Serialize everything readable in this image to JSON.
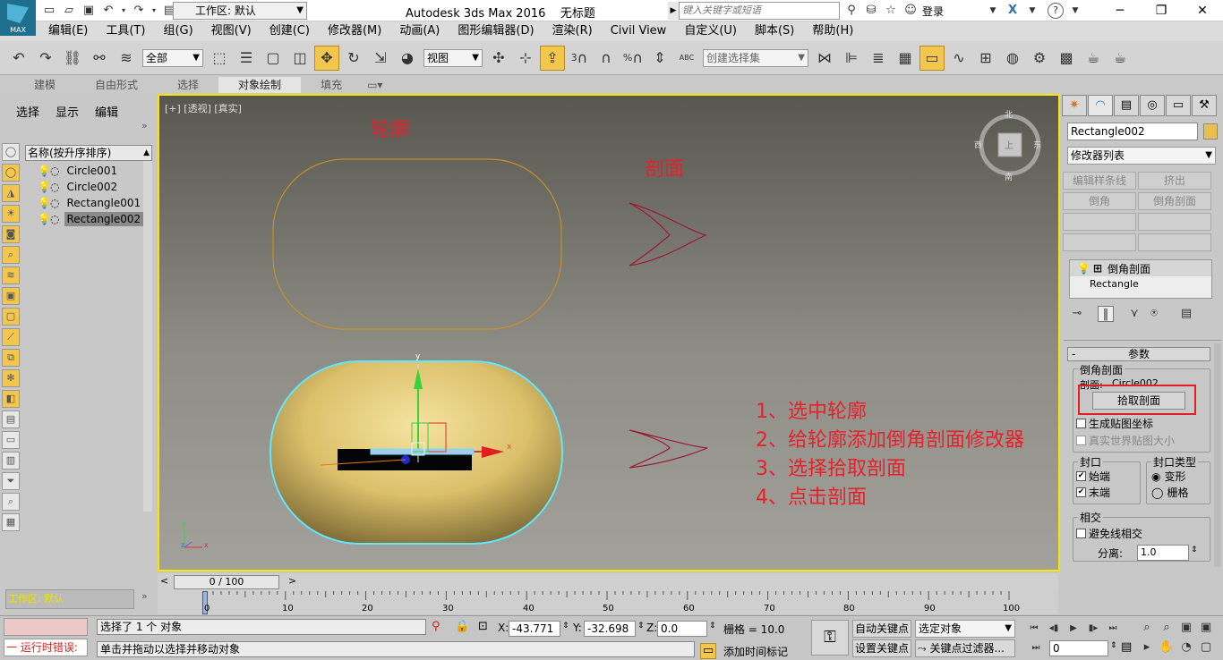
{
  "app": {
    "logo_text": "MAX",
    "title": "Autodesk 3ds Max 2016",
    "document": "无标题",
    "workspace": "工作区: 默认",
    "search_placeholder": "键入关键字或短语",
    "login": "登录",
    "window_min": "─",
    "window_restore": "❐",
    "window_close": "✕"
  },
  "menu": [
    "编辑(E)",
    "工具(T)",
    "组(G)",
    "视图(V)",
    "创建(C)",
    "修改器(M)",
    "动画(A)",
    "图形编辑器(D)",
    "渲染(R)",
    "Civil View",
    "自定义(U)",
    "脚本(S)",
    "帮助(H)"
  ],
  "toolbar": {
    "filter": "全部",
    "refcoord": "视图",
    "selset": "创建选择集",
    "num3": "3",
    "pct": "%",
    "abc": "ABC"
  },
  "ribbon_tabs": [
    "建模",
    "自由形式",
    "选择",
    "对象绘制",
    "填充"
  ],
  "ribbon_selected": "对象绘制",
  "left": {
    "menu": [
      "选择",
      "显示",
      "编辑"
    ],
    "expand": "»",
    "list_header": "名称(按升序排序)",
    "objects": [
      "Circle001",
      "Circle002",
      "Rectangle001",
      "Rectangle002"
    ],
    "selected": "Rectangle002",
    "workspace_status": "工作区: 默认"
  },
  "viewport": {
    "label": "[+] [透视] [真实]",
    "annot_profile": "轮廓",
    "annot_section": "剖面",
    "steps": [
      "1、选中轮廓",
      "2、给轮廓添加倒角剖面修改器",
      "3、选择拾取剖面",
      "4、点击剖面"
    ],
    "viewcube": {
      "n": "北",
      "s": "南",
      "e": "东",
      "w": "西",
      "top": "上"
    },
    "gizmo_x": "x",
    "gizmo_y": "y",
    "gizmo_z": "z"
  },
  "timeline": {
    "frame": "0 / 100",
    "prev": "<",
    "next": ">",
    "ticks": [
      "0",
      "10",
      "20",
      "30",
      "40",
      "50",
      "60",
      "70",
      "80",
      "90",
      "100"
    ]
  },
  "status": {
    "selected": "选择了 1 个 对象",
    "prompt": "单击并拖动以选择并移动对象",
    "runtime_error": "运行时错误:",
    "x_label": "X:",
    "x": "-43.771",
    "y_label": "Y:",
    "y": "-32.698",
    "z_label": "Z:",
    "z": "0.0",
    "grid": "栅格 = 10.0",
    "add_tag": "添加时间标记",
    "auto_key": "自动关键点",
    "set_key": "设置关键点",
    "sel_obj": "选定对象",
    "key_filter": "关键点过滤器...",
    "frame_field": "0"
  },
  "right": {
    "object_name": "Rectangle002",
    "modifier_list": "修改器列表",
    "buttons": [
      "编辑样条线",
      "挤出",
      "倒角",
      "倒角剖面",
      "",
      "",
      "",
      ""
    ],
    "stack": [
      "倒角剖面",
      "Rectangle"
    ],
    "rollout_title": "参数",
    "group_bevel_profile": "倒角剖面",
    "profile_label": "剖面:",
    "profile_value": "Circle002",
    "pick_button": "拾取剖面",
    "gen_mapping": "生成贴图坐标",
    "real_world": "真实世界贴图大小",
    "cap_group": "封口",
    "cap_start": "始端",
    "cap_end": "末端",
    "cap_type_group": "封口类型",
    "cap_morph": "变形",
    "cap_grid": "栅格",
    "intersect_group": "相交",
    "avoid_intersect": "避免线相交",
    "separation_label": "分离:",
    "separation_value": "1.0",
    "collapse": "-"
  },
  "colors": {
    "accent": "#f3c64d",
    "annotation": "#e8202a",
    "viewport_border": "#f7e600",
    "profile_curve": "#c8902a",
    "section_curve": "#9a1a35",
    "selection_outline": "#60e8ff"
  }
}
